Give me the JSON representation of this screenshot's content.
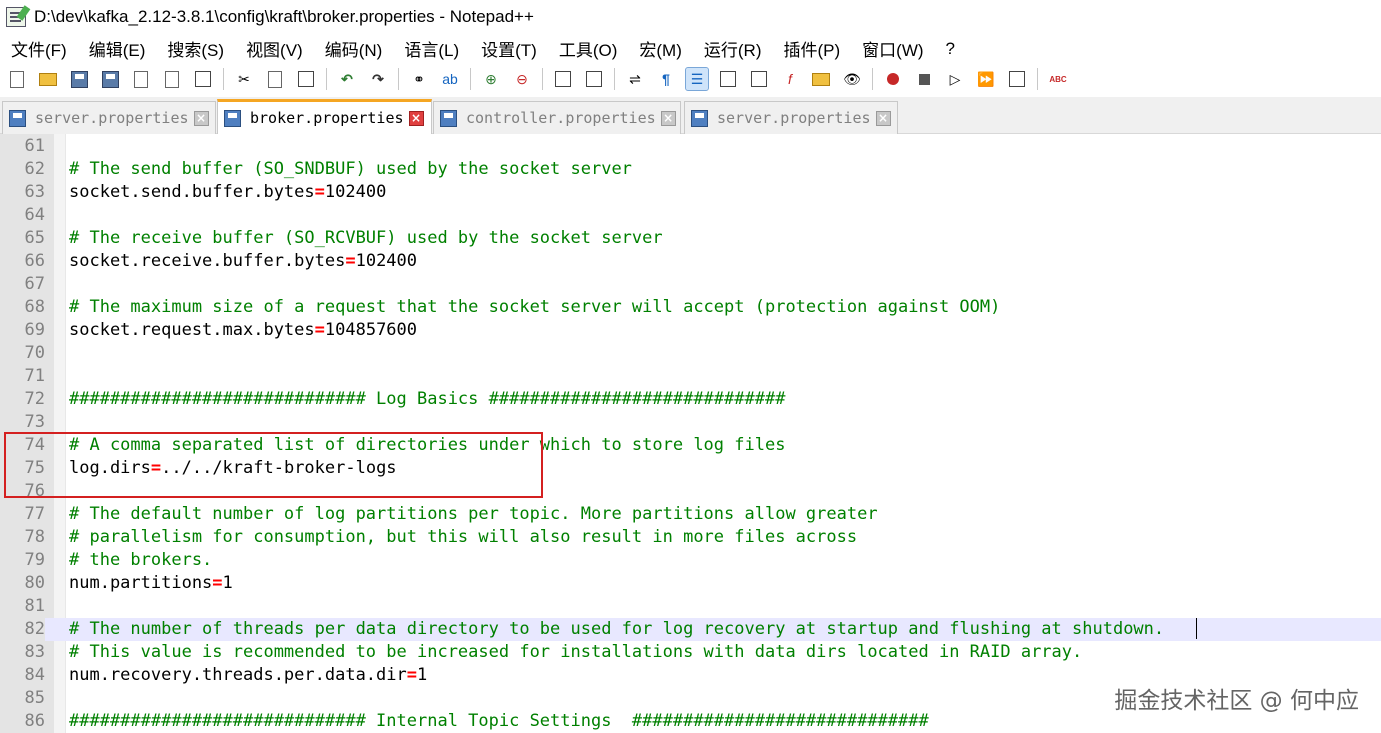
{
  "window": {
    "title": "D:\\dev\\kafka_2.12-3.8.1\\config\\kraft\\broker.properties - Notepad++"
  },
  "menu": [
    "文件(F)",
    "编辑(E)",
    "搜索(S)",
    "视图(V)",
    "编码(N)",
    "语言(L)",
    "设置(T)",
    "工具(O)",
    "宏(M)",
    "运行(R)",
    "插件(P)",
    "窗口(W)",
    "?"
  ],
  "tabs": [
    {
      "label": "server.properties",
      "active": false
    },
    {
      "label": "broker.properties",
      "active": true
    },
    {
      "label": "controller.properties",
      "active": false
    },
    {
      "label": "server.properties",
      "active": false
    }
  ],
  "editor": {
    "lines": [
      {
        "n": "61",
        "comment": "",
        "key": "",
        "value": ""
      },
      {
        "n": "62",
        "comment": "# The send buffer (SO_SNDBUF) used by the socket server",
        "key": "",
        "value": ""
      },
      {
        "n": "63",
        "comment": "",
        "key": "socket.send.buffer.bytes",
        "value": "102400"
      },
      {
        "n": "64",
        "comment": "",
        "key": "",
        "value": ""
      },
      {
        "n": "65",
        "comment": "# The receive buffer (SO_RCVBUF) used by the socket server",
        "key": "",
        "value": ""
      },
      {
        "n": "66",
        "comment": "",
        "key": "socket.receive.buffer.bytes",
        "value": "102400"
      },
      {
        "n": "67",
        "comment": "",
        "key": "",
        "value": ""
      },
      {
        "n": "68",
        "comment": "# The maximum size of a request that the socket server will accept (protection against OOM)",
        "key": "",
        "value": ""
      },
      {
        "n": "69",
        "comment": "",
        "key": "socket.request.max.bytes",
        "value": "104857600"
      },
      {
        "n": "70",
        "comment": "",
        "key": "",
        "value": ""
      },
      {
        "n": "71",
        "comment": "",
        "key": "",
        "value": ""
      },
      {
        "n": "72",
        "comment": "############################# Log Basics #############################",
        "key": "",
        "value": ""
      },
      {
        "n": "73",
        "comment": "",
        "key": "",
        "value": ""
      },
      {
        "n": "74",
        "comment": "# A comma separated list of directories under which to store log files",
        "key": "",
        "value": ""
      },
      {
        "n": "75",
        "comment": "",
        "key": "log.dirs",
        "value": "../../kraft-broker-logs"
      },
      {
        "n": "76",
        "comment": "",
        "key": "",
        "value": ""
      },
      {
        "n": "77",
        "comment": "# The default number of log partitions per topic. More partitions allow greater",
        "key": "",
        "value": ""
      },
      {
        "n": "78",
        "comment": "# parallelism for consumption, but this will also result in more files across",
        "key": "",
        "value": ""
      },
      {
        "n": "79",
        "comment": "# the brokers.",
        "key": "",
        "value": ""
      },
      {
        "n": "80",
        "comment": "",
        "key": "num.partitions",
        "value": "1"
      },
      {
        "n": "81",
        "comment": "",
        "key": "",
        "value": ""
      },
      {
        "n": "82",
        "comment": "# The number of threads per data directory to be used for log recovery at startup and flushing at shutdown.",
        "key": "",
        "value": ""
      },
      {
        "n": "83",
        "comment": "# This value is recommended to be increased for installations with data dirs located in RAID array.",
        "key": "",
        "value": ""
      },
      {
        "n": "84",
        "comment": "",
        "key": "num.recovery.threads.per.data.dir",
        "value": "1"
      },
      {
        "n": "85",
        "comment": "",
        "key": "",
        "value": ""
      },
      {
        "n": "86",
        "comment": "############################# Internal Topic Settings  #############################",
        "key": "",
        "value": ""
      }
    ],
    "current_line": "82",
    "equals_sign": "="
  },
  "watermark": "掘金技术社区 @ 何中应",
  "colors": {
    "comment": "#008000",
    "operator": "#ff0000",
    "current_line_bg": "#e8e8ff",
    "active_tab_accent": "#f5a623",
    "annotation_box": "#d42020"
  }
}
